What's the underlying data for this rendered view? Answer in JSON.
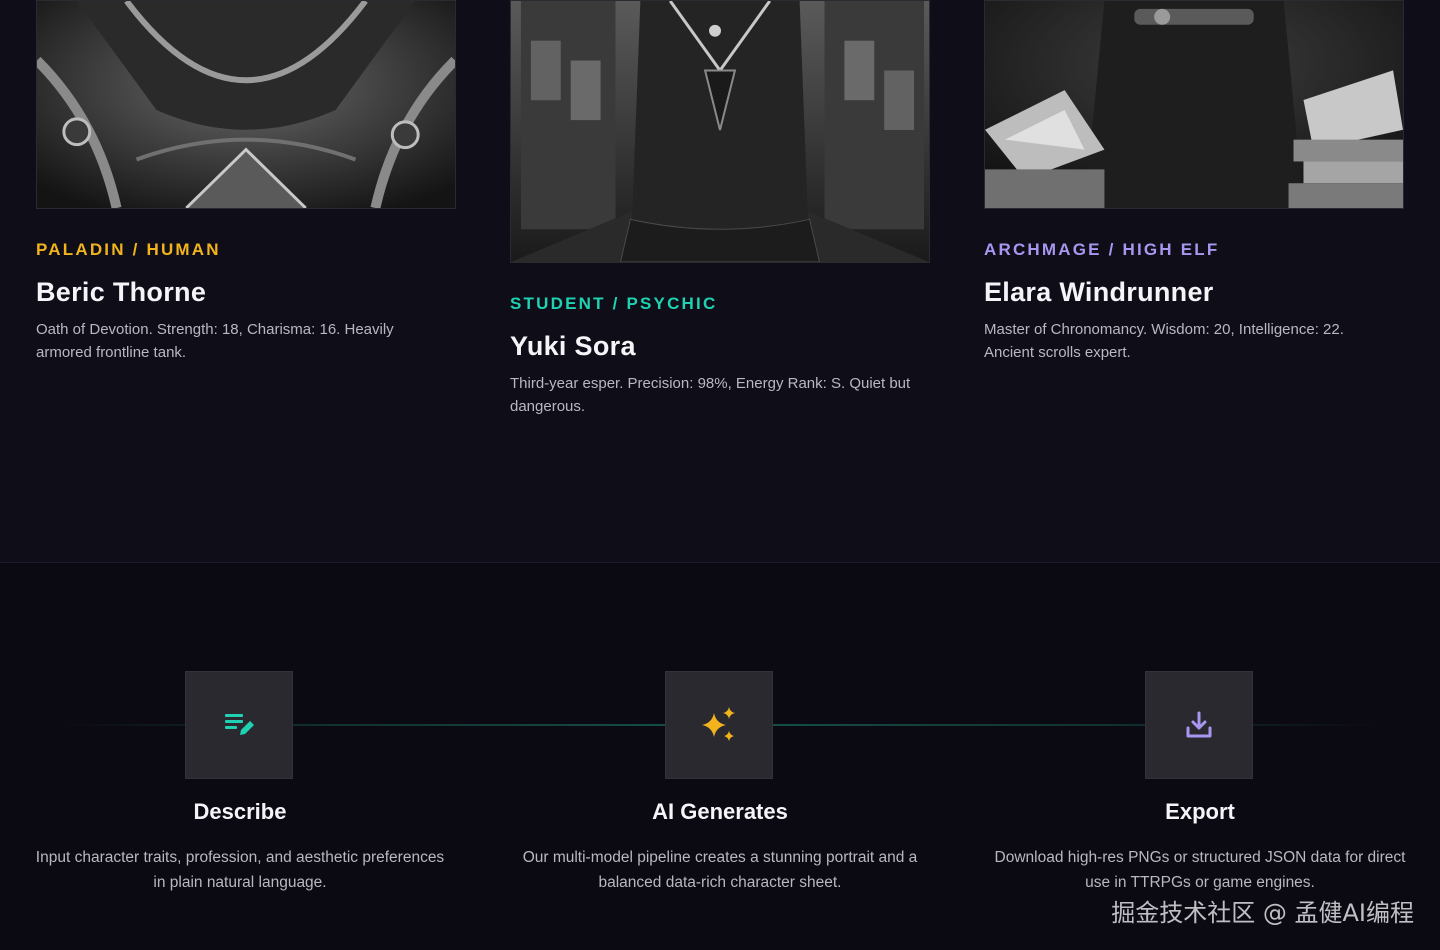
{
  "characters": [
    {
      "role": "PALADIN / HUMAN",
      "name": "Beric Thorne",
      "description": "Oath of Devotion. Strength: 18, Charisma: 16. Heavily armored frontline tank.",
      "accent": "#f2b31c"
    },
    {
      "role": "STUDENT / PSYCHIC",
      "name": "Yuki Sora",
      "description": "Third-year esper. Precision: 98%, Energy Rank: S. Quiet but dangerous.",
      "accent": "#1ed2b2"
    },
    {
      "role": "ARCHMAGE / HIGH ELF",
      "name": "Elara Windrunner",
      "description": "Master of Chronomancy. Wisdom: 20, Intelligence: 22. Ancient scrolls expert.",
      "accent": "#a996f0"
    }
  ],
  "steps": [
    {
      "icon": "edit-notes-icon",
      "title": "Describe",
      "text": "Input character traits, profession, and aesthetic preferences in plain natural language."
    },
    {
      "icon": "sparkles-icon",
      "title": "AI Generates",
      "text": "Our multi-model pipeline creates a stunning portrait and a balanced data-rich character sheet."
    },
    {
      "icon": "download-icon",
      "title": "Export",
      "text": "Download high-res PNGs or structured JSON data for direct use in TTRPGs or game engines."
    }
  ],
  "watermark": "掘金技术社区 @ 孟健AI编程"
}
